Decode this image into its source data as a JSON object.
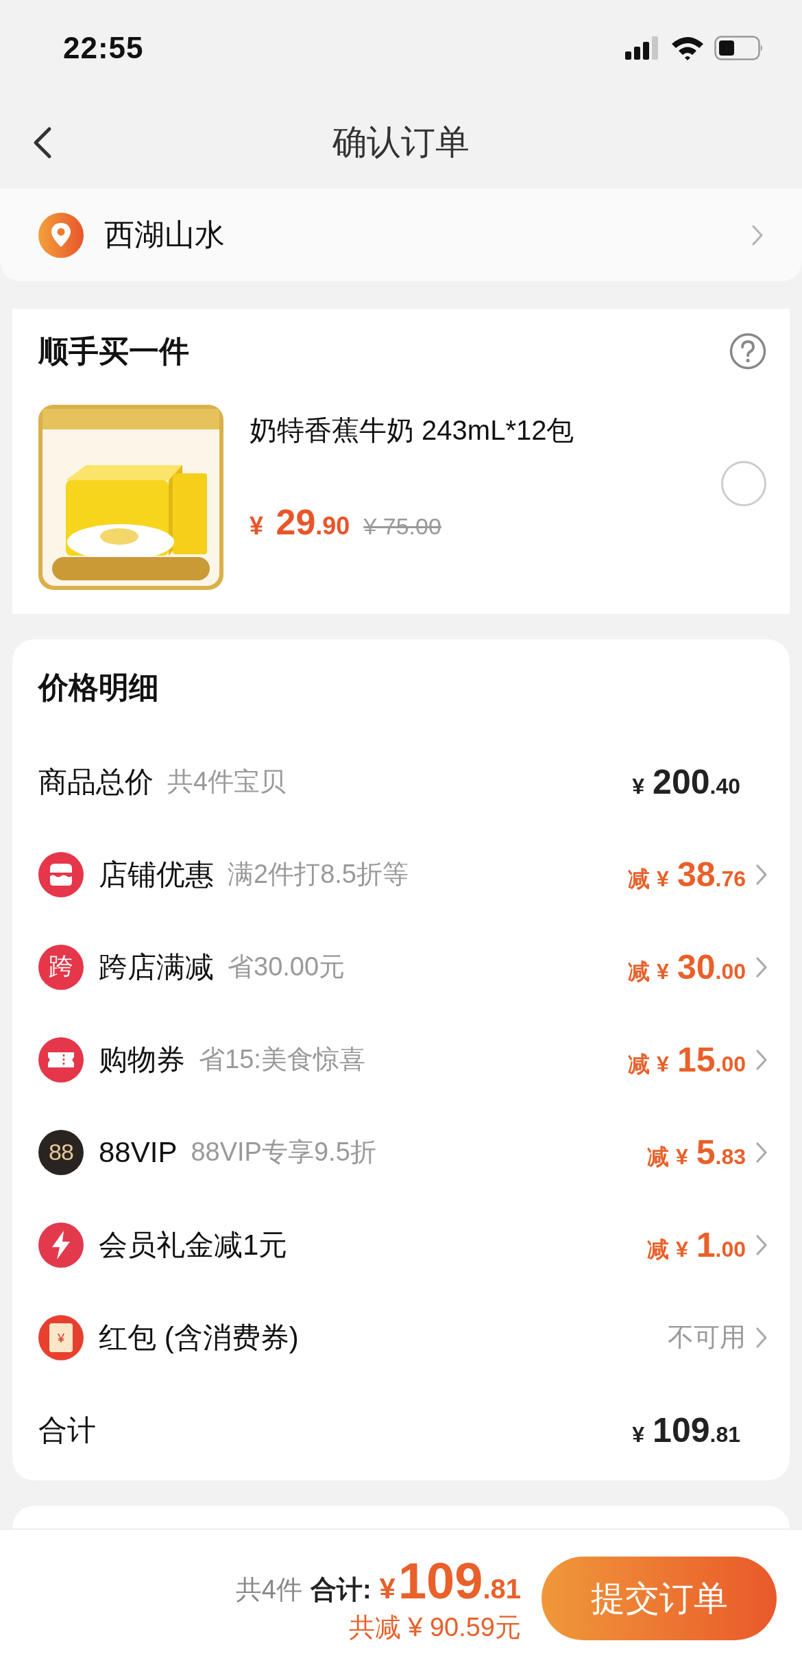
{
  "status_bar": {
    "time": "22:55"
  },
  "nav": {
    "title": "确认订单"
  },
  "address": {
    "text": "西湖山水"
  },
  "addon": {
    "title": "顺手买一件",
    "product": {
      "name": "奶特香蕉牛奶 243mL*12包",
      "currency": "¥",
      "price_int": "29",
      "price_dec": ".90",
      "original_price": "¥ 75.00",
      "selected": false
    }
  },
  "price_detail": {
    "title": "价格明细",
    "rows": [
      {
        "kind": "subtotal",
        "label": "商品总价",
        "note": "共4件宝贝",
        "currency": "¥",
        "amount_int": "200",
        "amount_dec": ".40"
      },
      {
        "kind": "discount",
        "label": "店铺优惠",
        "note": "满2件打8.5折等",
        "prefix": "减",
        "currency": "¥",
        "amount_int": "38",
        "amount_dec": ".76"
      },
      {
        "kind": "discount",
        "icon_text": "跨",
        "label": "跨店满减",
        "note": "省30.00元",
        "prefix": "减",
        "currency": "¥",
        "amount_int": "30",
        "amount_dec": ".00"
      },
      {
        "kind": "discount",
        "label": "购物券",
        "note": "省15:美食惊喜",
        "prefix": "减",
        "currency": "¥",
        "amount_int": "15",
        "amount_dec": ".00"
      },
      {
        "kind": "discount",
        "icon_text": "88",
        "label": "88VIP",
        "note": "88VIP专享9.5折",
        "prefix": "减",
        "currency": "¥",
        "amount_int": "5",
        "amount_dec": ".83"
      },
      {
        "kind": "discount",
        "label": "会员礼金减1元",
        "prefix": "减",
        "currency": "¥",
        "amount_int": "1",
        "amount_dec": ".00"
      },
      {
        "kind": "unavailable",
        "icon_text": "¥",
        "label": "红包 (含消费券)",
        "value": "不可用"
      },
      {
        "kind": "total",
        "label": "合计",
        "currency": "¥",
        "amount_int": "109",
        "amount_dec": ".81"
      }
    ]
  },
  "bottom_bar": {
    "count": "共4件",
    "total_label": "合计:",
    "currency": "¥",
    "amount_int": "109",
    "amount_dec": ".81",
    "savings": "共减 ¥ 90.59元",
    "submit": "提交订单"
  }
}
